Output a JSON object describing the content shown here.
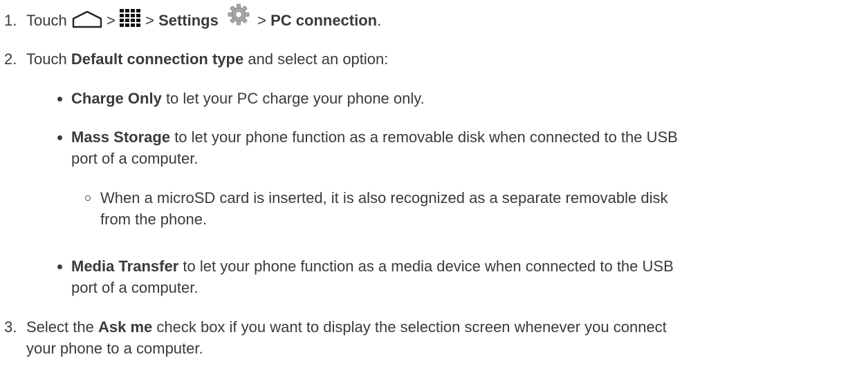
{
  "steps": [
    {
      "number": "1.",
      "touch": "Touch",
      "sep1": ">",
      "sep2": ">",
      "settings": "Settings",
      "sep3": ">",
      "pc_connection": "PC connection",
      "end": ".",
      "icons": [
        "home-icon",
        "apps-grid-icon",
        "settings-gear-icon"
      ]
    },
    {
      "number": "2.",
      "touch": "Touch",
      "bold": "Default connection type",
      "rest": "and select an option:"
    },
    {
      "number": "3.",
      "pre": "Select the",
      "bold": "Ask me",
      "rest_line1": "check box if you want to display the selection screen whenever you connect",
      "rest_line2": "your phone to a computer."
    }
  ],
  "options": [
    {
      "bold": "Charge Only",
      "rest": "to let your PC charge your phone only."
    },
    {
      "bold": "Mass Storage",
      "rest_line1": "to let your phone function as a removable disk when connected to the USB",
      "rest_line2": "port of a computer.",
      "sub": {
        "line1": "When a microSD card is inserted, it is also recognized as a separate removable disk",
        "line2": "from the phone."
      }
    },
    {
      "bold": "Media Transfer",
      "rest_line1": "to let your phone function as a media device when connected to the USB",
      "rest_line2": "port of a computer."
    }
  ]
}
